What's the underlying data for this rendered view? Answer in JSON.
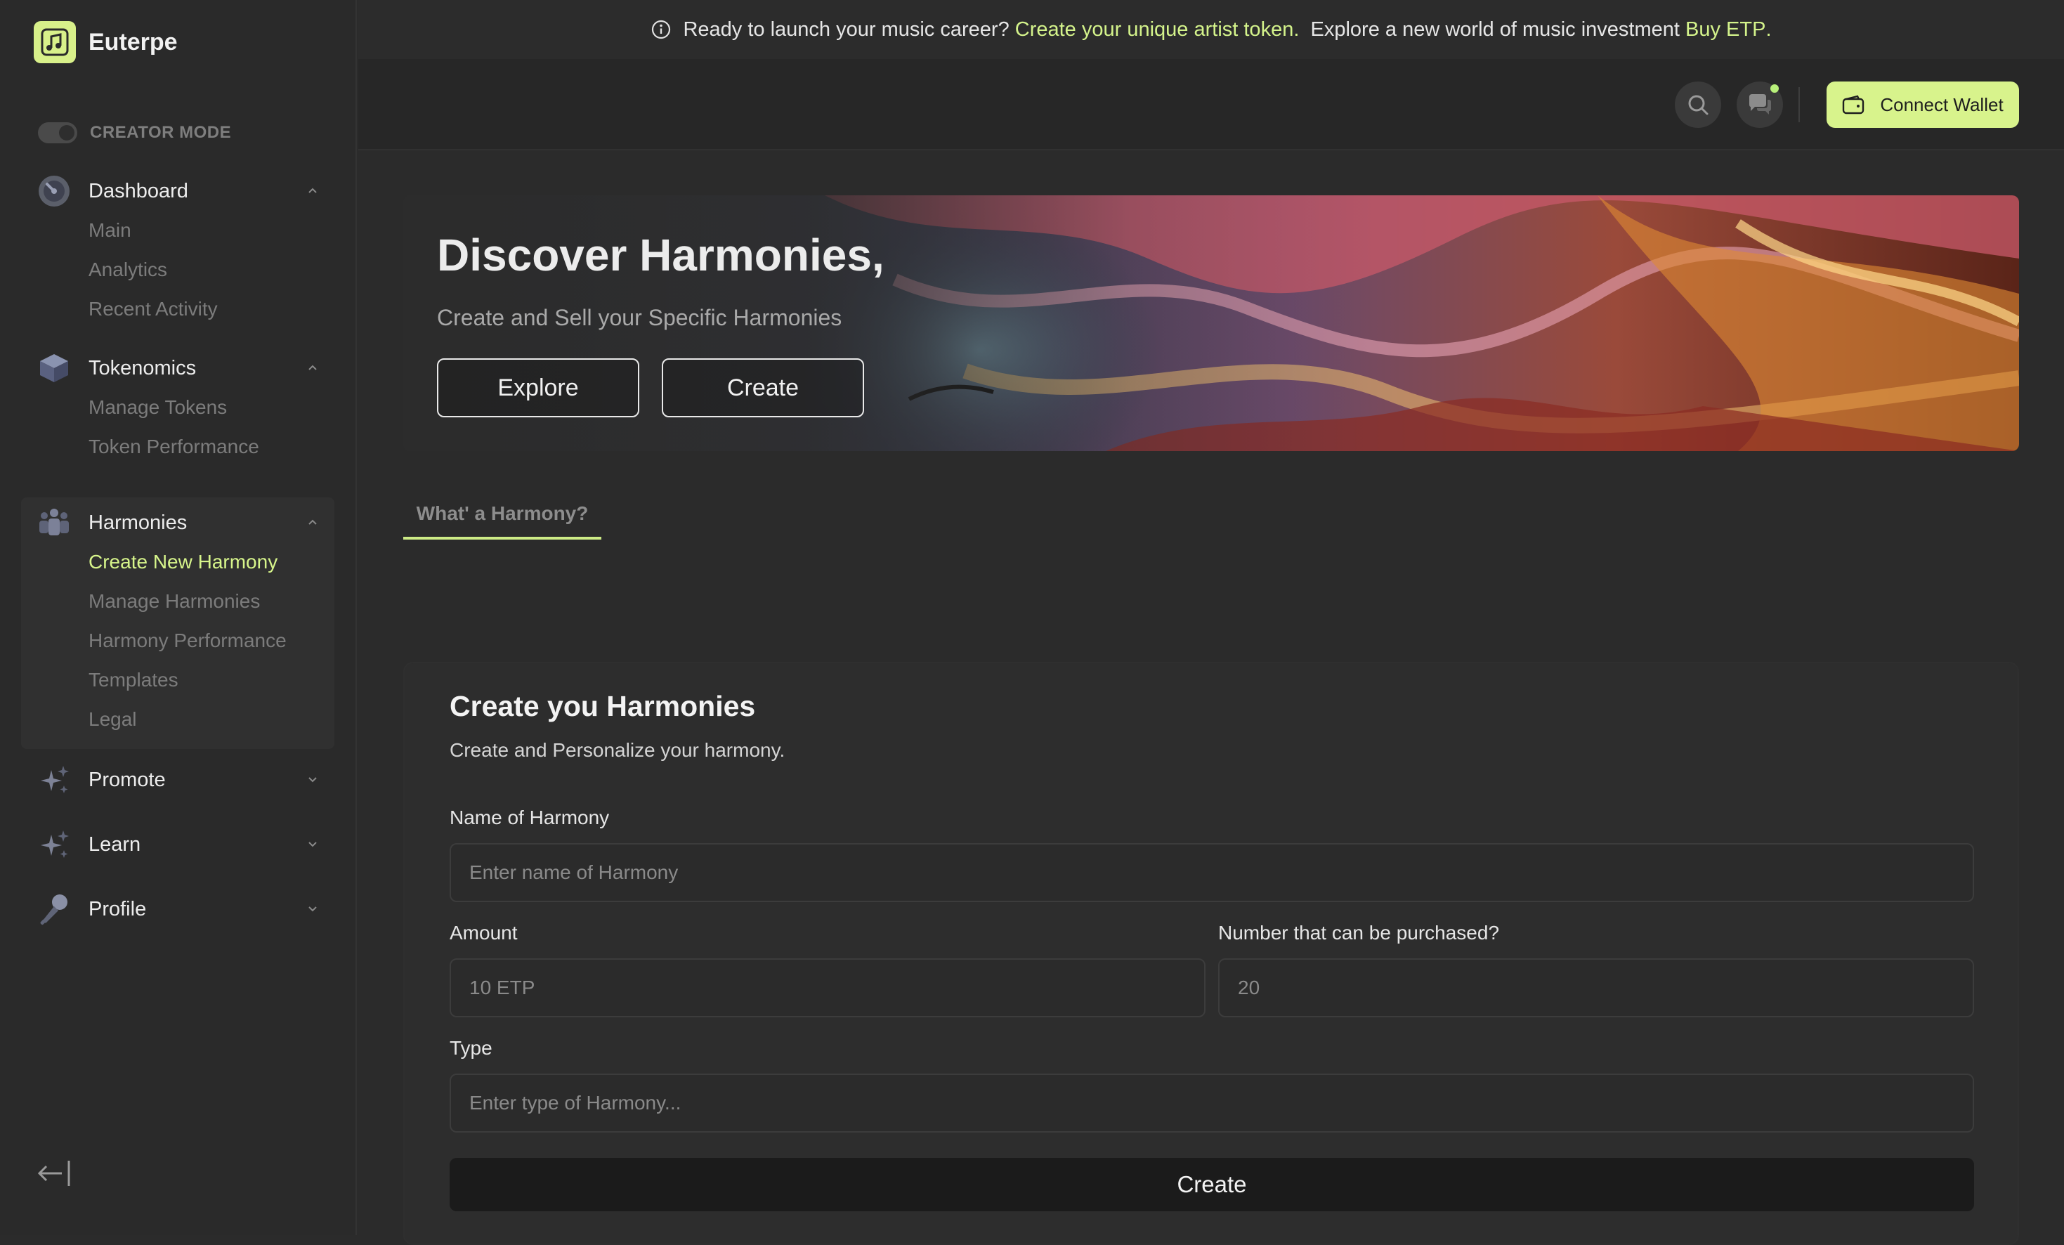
{
  "app": {
    "name": "Euterpe",
    "accent": "#d8f38c"
  },
  "sidebar": {
    "creator_mode_label": "CREATOR MODE",
    "groups": [
      {
        "label": "Dashboard",
        "icon": "dashboard-icon",
        "expanded": true,
        "items": [
          "Main",
          "Analytics",
          "Recent Activity"
        ]
      },
      {
        "label": "Tokenomics",
        "icon": "cube-icon",
        "expanded": true,
        "items": [
          "Manage Tokens",
          "Token Performance"
        ]
      },
      {
        "label": "Harmonies",
        "icon": "people-icon",
        "expanded": true,
        "items": [
          "Create New Harmony",
          "Manage Harmonies",
          "Harmony Performance",
          "Templates",
          "Legal"
        ]
      },
      {
        "label": "Promote",
        "icon": "sparkle-icon",
        "expanded": false,
        "items": []
      },
      {
        "label": "Learn",
        "icon": "sparkle-icon",
        "expanded": false,
        "items": []
      },
      {
        "label": "Profile",
        "icon": "microphone-icon",
        "expanded": false,
        "items": []
      }
    ]
  },
  "announcement": {
    "prefix": "Ready to launch your music career?",
    "link1": "Create your unique artist token.",
    "middle": "Explore a new world of music investment",
    "link2": "Buy ETP",
    "suffix": "."
  },
  "header": {
    "connect_wallet_label": "Connect Wallet"
  },
  "hero": {
    "title": "Discover Harmonies,",
    "subtitle": "Create and Sell your Specific Harmonies",
    "explore_label": "Explore",
    "create_label": "Create"
  },
  "tabs": [
    {
      "label": "What' a Harmony?",
      "active": true
    }
  ],
  "form": {
    "title": "Create you Harmonies",
    "subtitle": "Create and Personalize your harmony.",
    "name_label": "Name of Harmony",
    "name_placeholder": "Enter name of Harmony",
    "amount_label": "Amount",
    "amount_placeholder": "10 ETP",
    "number_label": "Number that can be purchased?",
    "number_placeholder": "20",
    "type_label": "Type",
    "type_placeholder": "Enter type of Harmony...",
    "submit_label": "Create"
  }
}
